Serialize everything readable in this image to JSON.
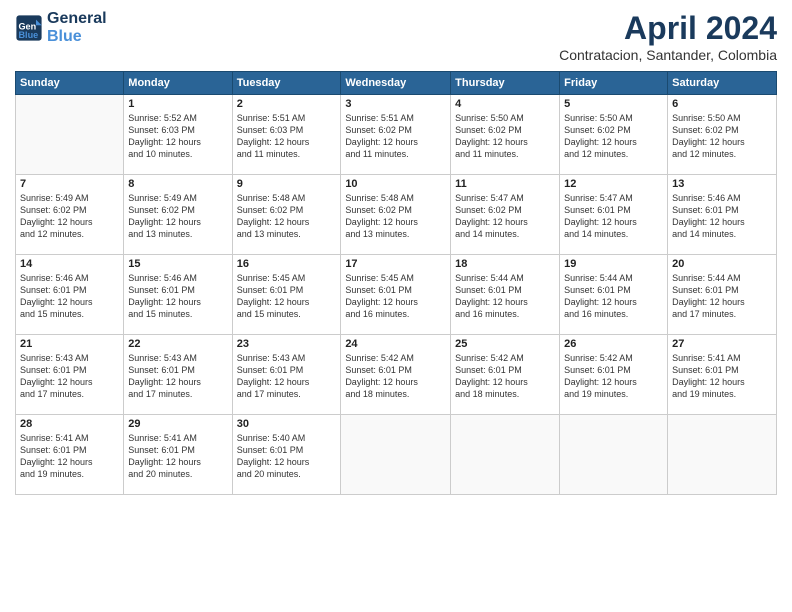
{
  "header": {
    "logo_line1": "General",
    "logo_line2": "Blue",
    "month": "April 2024",
    "location": "Contratacion, Santander, Colombia"
  },
  "weekdays": [
    "Sunday",
    "Monday",
    "Tuesday",
    "Wednesday",
    "Thursday",
    "Friday",
    "Saturday"
  ],
  "weeks": [
    [
      {
        "day": "",
        "info": ""
      },
      {
        "day": "1",
        "info": "Sunrise: 5:52 AM\nSunset: 6:03 PM\nDaylight: 12 hours\nand 10 minutes."
      },
      {
        "day": "2",
        "info": "Sunrise: 5:51 AM\nSunset: 6:03 PM\nDaylight: 12 hours\nand 11 minutes."
      },
      {
        "day": "3",
        "info": "Sunrise: 5:51 AM\nSunset: 6:02 PM\nDaylight: 12 hours\nand 11 minutes."
      },
      {
        "day": "4",
        "info": "Sunrise: 5:50 AM\nSunset: 6:02 PM\nDaylight: 12 hours\nand 11 minutes."
      },
      {
        "day": "5",
        "info": "Sunrise: 5:50 AM\nSunset: 6:02 PM\nDaylight: 12 hours\nand 12 minutes."
      },
      {
        "day": "6",
        "info": "Sunrise: 5:50 AM\nSunset: 6:02 PM\nDaylight: 12 hours\nand 12 minutes."
      }
    ],
    [
      {
        "day": "7",
        "info": ""
      },
      {
        "day": "8",
        "info": "Sunrise: 5:49 AM\nSunset: 6:02 PM\nDaylight: 12 hours\nand 13 minutes."
      },
      {
        "day": "9",
        "info": "Sunrise: 5:48 AM\nSunset: 6:02 PM\nDaylight: 12 hours\nand 13 minutes."
      },
      {
        "day": "10",
        "info": "Sunrise: 5:48 AM\nSunset: 6:02 PM\nDaylight: 12 hours\nand 13 minutes."
      },
      {
        "day": "11",
        "info": "Sunrise: 5:47 AM\nSunset: 6:02 PM\nDaylight: 12 hours\nand 14 minutes."
      },
      {
        "day": "12",
        "info": "Sunrise: 5:47 AM\nSunset: 6:01 PM\nDaylight: 12 hours\nand 14 minutes."
      },
      {
        "day": "13",
        "info": "Sunrise: 5:46 AM\nSunset: 6:01 PM\nDaylight: 12 hours\nand 14 minutes."
      }
    ],
    [
      {
        "day": "14",
        "info": ""
      },
      {
        "day": "15",
        "info": "Sunrise: 5:46 AM\nSunset: 6:01 PM\nDaylight: 12 hours\nand 15 minutes."
      },
      {
        "day": "16",
        "info": "Sunrise: 5:45 AM\nSunset: 6:01 PM\nDaylight: 12 hours\nand 15 minutes."
      },
      {
        "day": "17",
        "info": "Sunrise: 5:45 AM\nSunset: 6:01 PM\nDaylight: 12 hours\nand 16 minutes."
      },
      {
        "day": "18",
        "info": "Sunrise: 5:44 AM\nSunset: 6:01 PM\nDaylight: 12 hours\nand 16 minutes."
      },
      {
        "day": "19",
        "info": "Sunrise: 5:44 AM\nSunset: 6:01 PM\nDaylight: 12 hours\nand 16 minutes."
      },
      {
        "day": "20",
        "info": "Sunrise: 5:44 AM\nSunset: 6:01 PM\nDaylight: 12 hours\nand 17 minutes."
      }
    ],
    [
      {
        "day": "21",
        "info": ""
      },
      {
        "day": "22",
        "info": "Sunrise: 5:43 AM\nSunset: 6:01 PM\nDaylight: 12 hours\nand 17 minutes."
      },
      {
        "day": "23",
        "info": "Sunrise: 5:43 AM\nSunset: 6:01 PM\nDaylight: 12 hours\nand 17 minutes."
      },
      {
        "day": "24",
        "info": "Sunrise: 5:42 AM\nSunset: 6:01 PM\nDaylight: 12 hours\nand 18 minutes."
      },
      {
        "day": "25",
        "info": "Sunrise: 5:42 AM\nSunset: 6:01 PM\nDaylight: 12 hours\nand 18 minutes."
      },
      {
        "day": "26",
        "info": "Sunrise: 5:42 AM\nSunset: 6:01 PM\nDaylight: 12 hours\nand 19 minutes."
      },
      {
        "day": "27",
        "info": "Sunrise: 5:41 AM\nSunset: 6:01 PM\nDaylight: 12 hours\nand 19 minutes."
      }
    ],
    [
      {
        "day": "28",
        "info": "Sunrise: 5:41 AM\nSunset: 6:01 PM\nDaylight: 12 hours\nand 19 minutes."
      },
      {
        "day": "29",
        "info": "Sunrise: 5:41 AM\nSunset: 6:01 PM\nDaylight: 12 hours\nand 20 minutes."
      },
      {
        "day": "30",
        "info": "Sunrise: 5:40 AM\nSunset: 6:01 PM\nDaylight: 12 hours\nand 20 minutes."
      },
      {
        "day": "",
        "info": ""
      },
      {
        "day": "",
        "info": ""
      },
      {
        "day": "",
        "info": ""
      },
      {
        "day": "",
        "info": ""
      }
    ]
  ],
  "week7_sunday_info": "Sunrise: 5:49 AM\nSunset: 6:02 PM\nDaylight: 12 hours\nand 12 minutes.",
  "week14_sunday_info": "Sunrise: 5:46 AM\nSunset: 6:01 PM\nDaylight: 12 hours\nand 15 minutes.",
  "week21_sunday_info": "Sunrise: 5:43 AM\nSunset: 6:01 PM\nDaylight: 12 hours\nand 17 minutes."
}
